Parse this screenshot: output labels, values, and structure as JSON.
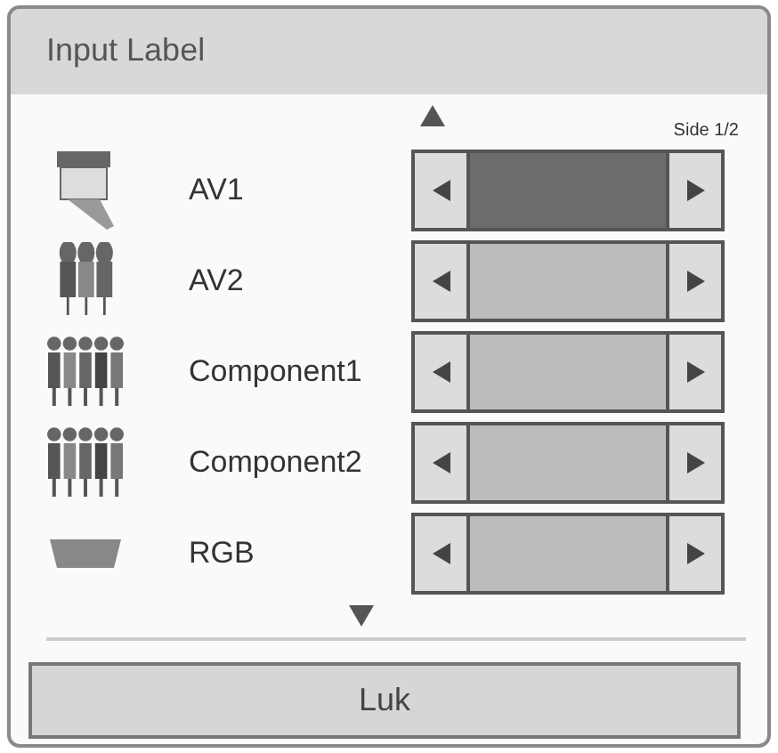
{
  "window": {
    "title": "Input Label"
  },
  "page_indicator": "Side 1/2",
  "inputs": [
    {
      "name": "AV1",
      "kind": "scart",
      "selected": true
    },
    {
      "name": "AV2",
      "kind": "av",
      "selected": false
    },
    {
      "name": "Component1",
      "kind": "component",
      "selected": false
    },
    {
      "name": "Component2",
      "kind": "component",
      "selected": false
    },
    {
      "name": "RGB",
      "kind": "rgb",
      "selected": false
    }
  ],
  "buttons": [
    "Luk"
  ]
}
